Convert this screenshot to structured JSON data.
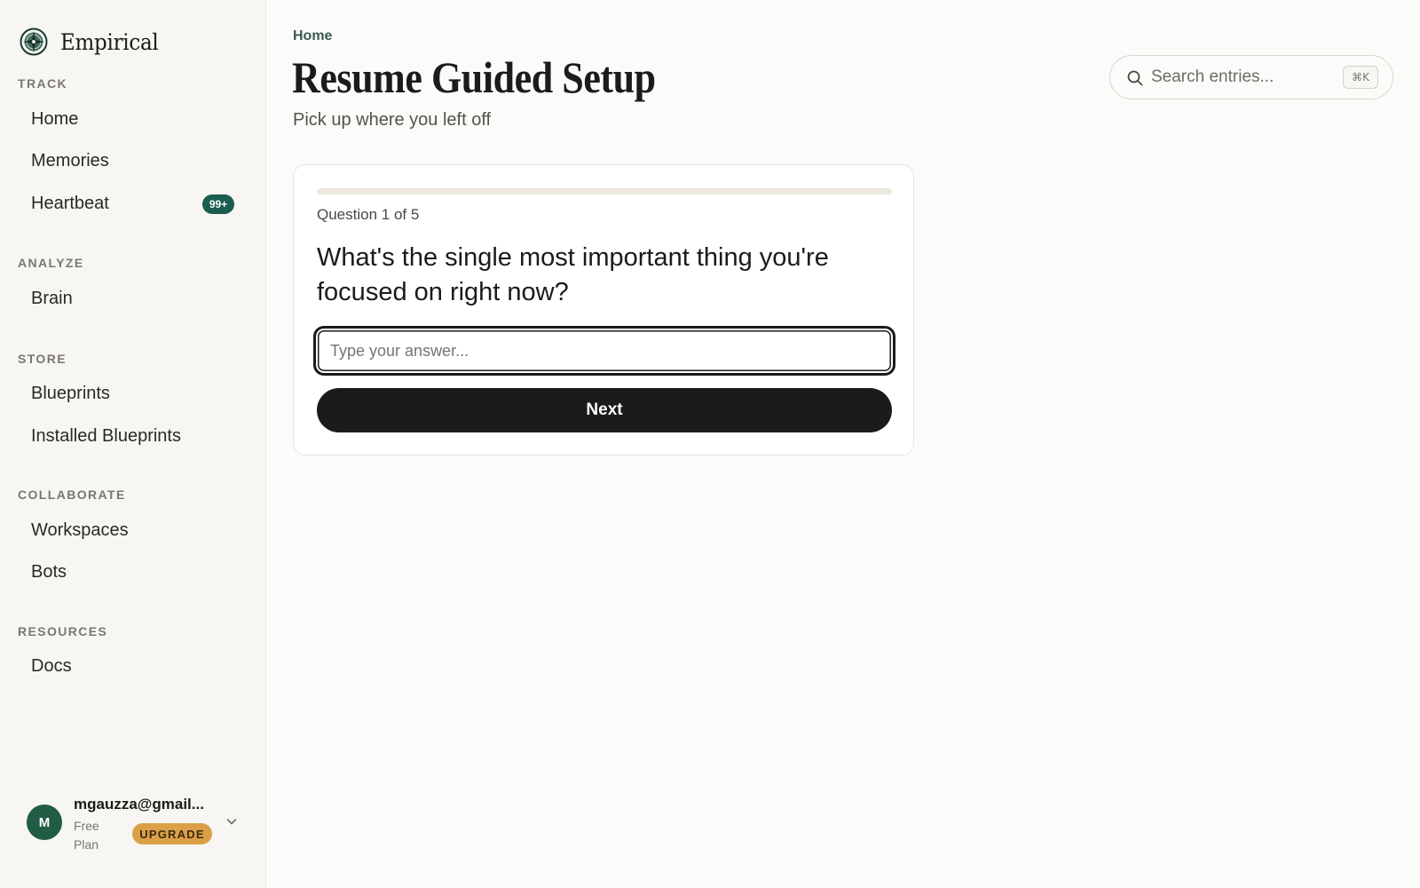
{
  "brand": {
    "name": "Empirical",
    "logo_icon": "compass-logo-icon"
  },
  "sidebar": {
    "sections": [
      {
        "label": "TRACK",
        "items": [
          {
            "label": "Home"
          },
          {
            "label": "Memories"
          },
          {
            "label": "Heartbeat",
            "badge": "99+"
          }
        ]
      },
      {
        "label": "ANALYZE",
        "items": [
          {
            "label": "Brain"
          }
        ]
      },
      {
        "label": "STORE",
        "items": [
          {
            "label": "Blueprints"
          },
          {
            "label": "Installed Blueprints"
          }
        ]
      },
      {
        "label": "COLLABORATE",
        "items": [
          {
            "label": "Workspaces"
          },
          {
            "label": "Bots"
          }
        ]
      },
      {
        "label": "RESOURCES",
        "items": [
          {
            "label": "Docs"
          }
        ]
      }
    ]
  },
  "user": {
    "avatar_initial": "M",
    "email": "mgauzza@gmail...",
    "plan": "Free Plan",
    "upgrade_label": "UPGRADE"
  },
  "header": {
    "breadcrumb": "Home",
    "title": "Resume Guided Setup",
    "subtitle": "Pick up where you left off"
  },
  "search": {
    "placeholder": "Search entries...",
    "shortcut": "⌘K"
  },
  "setup": {
    "progress_fraction": 0.0,
    "question_count": "Question 1 of 5",
    "question": "What's the single most important thing you're focused on right now?",
    "answer_placeholder": "Type your answer...",
    "answer_value": "",
    "next_label": "Next"
  },
  "colors": {
    "accent": "#1b5d4e",
    "upgrade": "#dba047",
    "button": "#1c1b19",
    "background": "#fcfbf9"
  }
}
